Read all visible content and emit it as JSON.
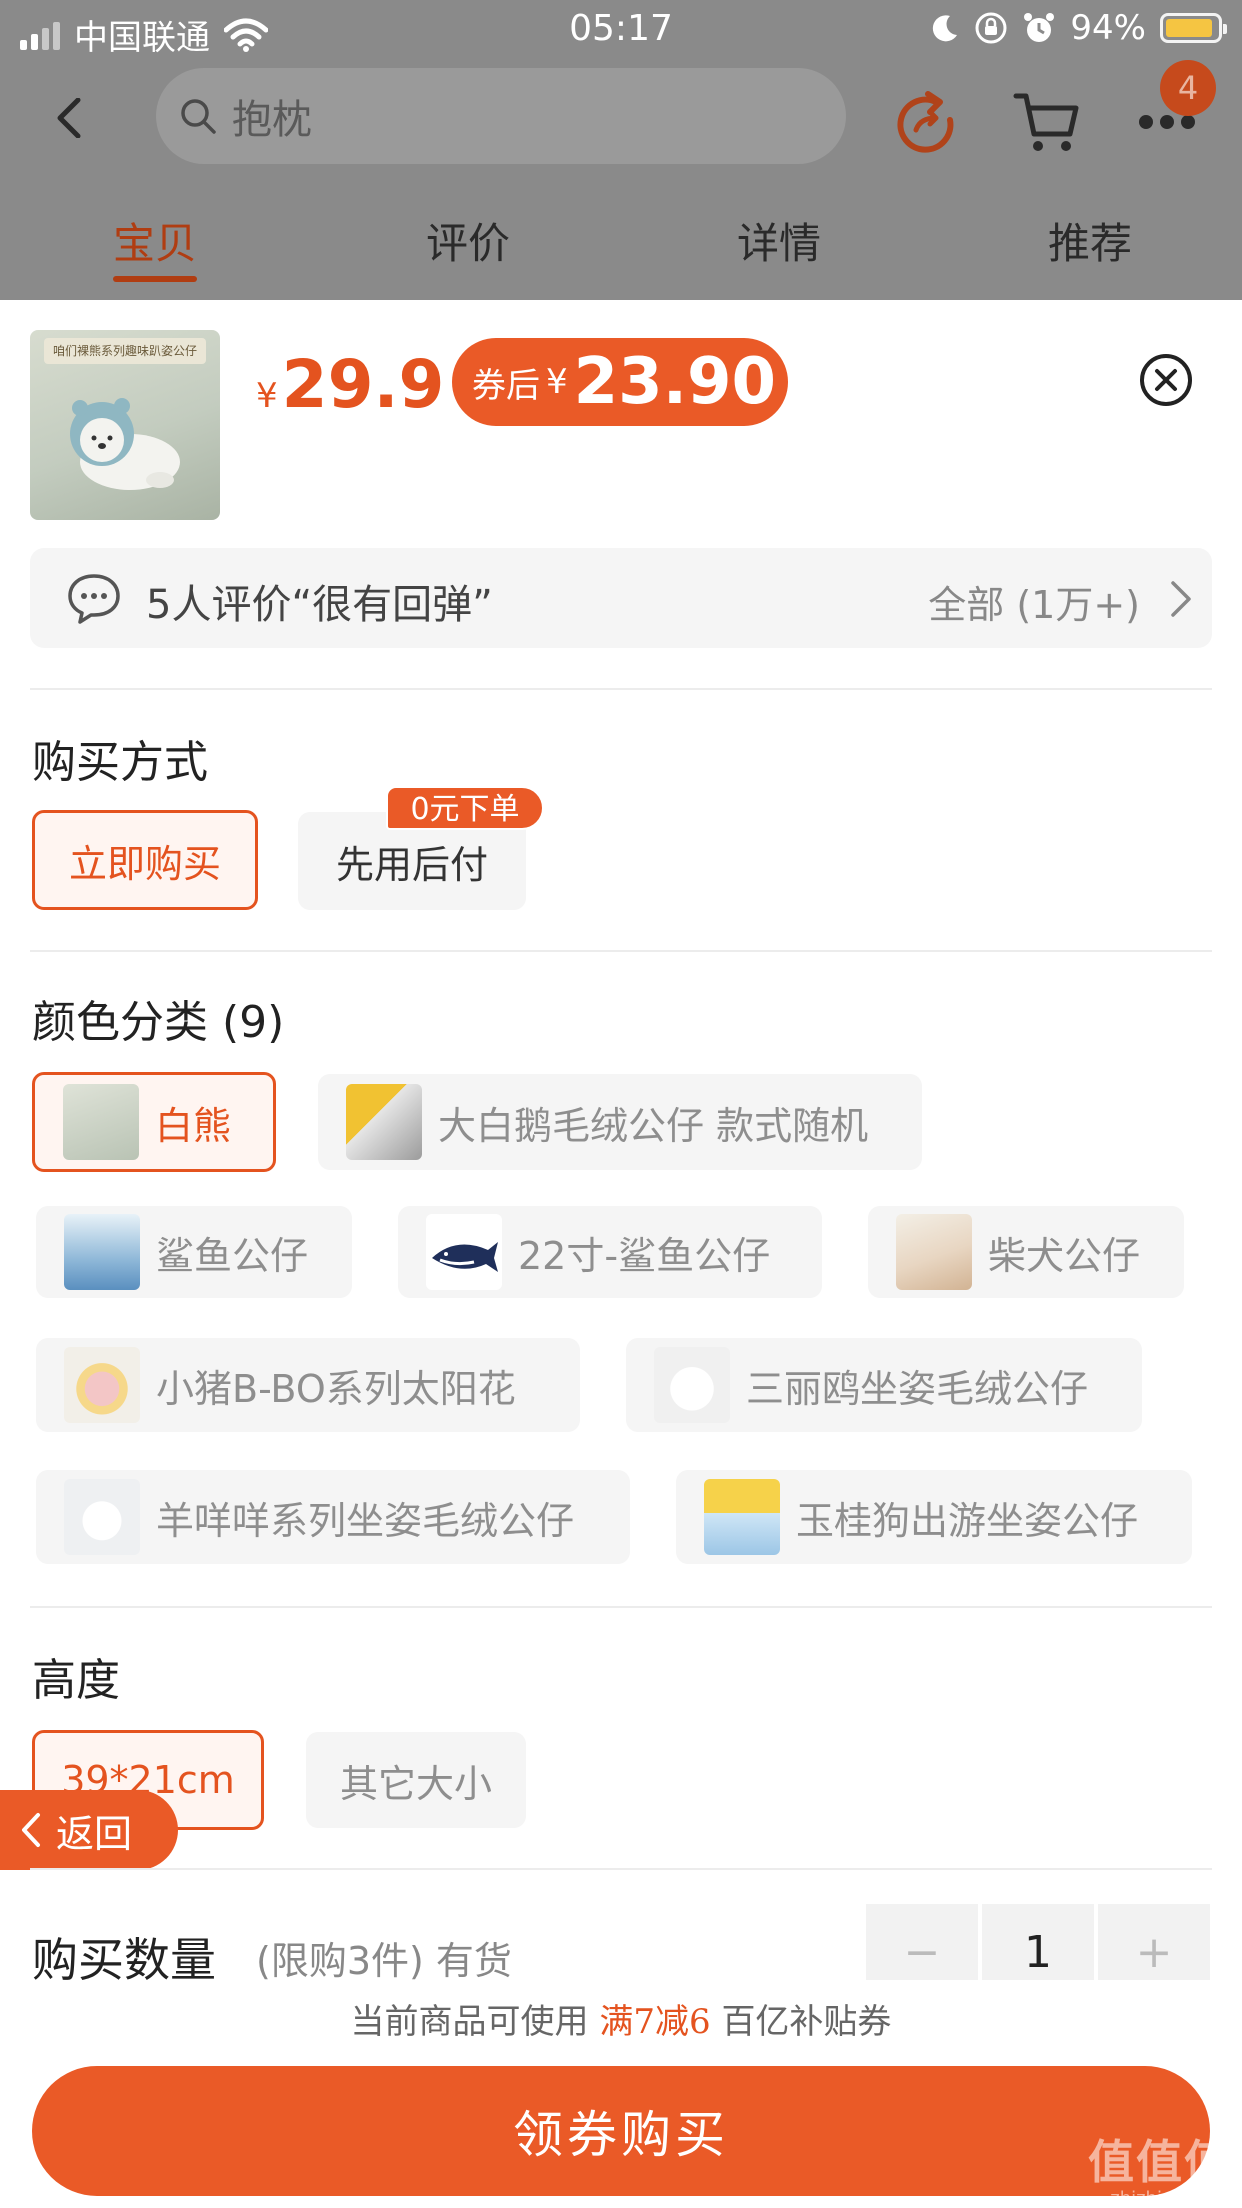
{
  "status_bar": {
    "carrier": "中国联通",
    "time": "05:17",
    "battery": "94%",
    "battery_color": "#f5c542"
  },
  "header": {
    "search_text": "抱枕",
    "cart_badge": "4",
    "icons": [
      "back-arrow-icon",
      "search-icon",
      "refresh-icon",
      "cart-icon",
      "more-icon"
    ]
  },
  "tabs": [
    {
      "label": "宝贝",
      "active": true
    },
    {
      "label": "评价",
      "active": false
    },
    {
      "label": "详情",
      "active": false
    },
    {
      "label": "推荐",
      "active": false
    }
  ],
  "product": {
    "thumb_banner": "咱们裸熊系列趣味趴姿公仔",
    "currency": "¥",
    "price": "29.9",
    "coupon_label": "券后",
    "coupon_price": "23.90"
  },
  "review": {
    "text": "5人评价“很有回弹”",
    "all": "全部 (1万+)"
  },
  "purchase_method": {
    "title": "购买方式",
    "options": [
      {
        "label": "立即购买",
        "selected": true
      },
      {
        "label": "先用后付",
        "selected": false,
        "tag": "0元下单"
      }
    ]
  },
  "color": {
    "title": "颜色分类 (9)",
    "options": [
      {
        "label": "白熊",
        "selected": true
      },
      {
        "label": "大白鹅毛绒公仔 款式随机",
        "selected": false
      },
      {
        "label": "鲨鱼公仔",
        "selected": false
      },
      {
        "label": "22寸-鲨鱼公仔",
        "selected": false
      },
      {
        "label": "柴犬公仔",
        "selected": false
      },
      {
        "label": "小猪B-BO系列太阳花",
        "selected": false
      },
      {
        "label": "三丽鸥坐姿毛绒公仔",
        "selected": false
      },
      {
        "label": "羊咩咩系列坐姿毛绒公仔",
        "selected": false
      },
      {
        "label": "玉桂狗出游坐姿公仔",
        "selected": false
      }
    ]
  },
  "height": {
    "title": "高度",
    "options": [
      {
        "label": "39*21cm",
        "selected": true
      },
      {
        "label": "其它大小",
        "selected": false
      }
    ]
  },
  "quantity": {
    "title": "购买数量",
    "note": "(限购3件) 有货",
    "minus": "−",
    "value": "1",
    "plus": "+"
  },
  "coupon_note": {
    "prefix": "当前商品可使用",
    "highlight": "满7减6",
    "suffix": "百亿补贴券"
  },
  "buy_button": "领券购买",
  "back_float": "返回",
  "watermark": {
    "big": "值值值",
    "small": "zhizhizhi.com"
  },
  "colors": {
    "accent": "#ea5a27",
    "accent_text": "#e4531f",
    "overlay": "#8a8a8a"
  }
}
